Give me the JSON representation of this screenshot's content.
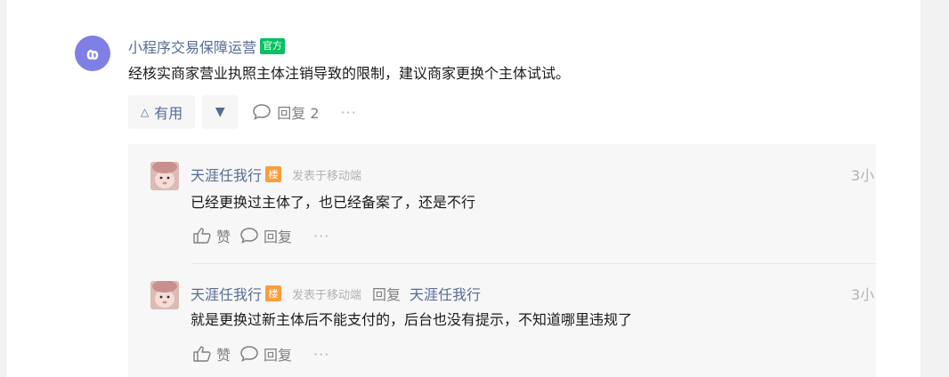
{
  "official_reply": {
    "author": "小程序交易保障运营",
    "badge": "官方",
    "content": "经核实商家营业执照主体注销导致的限制，建议商家更换个主体试试。",
    "useful_label": "有用",
    "useful_icon": "triangle-up-icon",
    "downvote_icon": "triangle-down-icon",
    "reply_label": "回复 2",
    "more_label": "···"
  },
  "sub_replies": [
    {
      "author": "天涯任我行",
      "badge": "楼",
      "source": "发表于移动端",
      "time": "3小",
      "content": "已经更换过主体了，也已经备案了，还是不行",
      "like_label": "赞",
      "reply_label": "回复",
      "more_label": "···"
    },
    {
      "author": "天涯任我行",
      "badge": "楼",
      "source": "发表于移动端",
      "reply_word": "回复",
      "reply_to": "天涯任我行",
      "time": "3小",
      "content": "就是更换过新主体后不能支付的，后台也没有提示，不知道哪里违规了",
      "like_label": "赞",
      "reply_label": "回复",
      "more_label": "···"
    }
  ],
  "colors": {
    "link": "#576b95",
    "official_green": "#07c160",
    "floor_orange": "#fa9d3b",
    "avatar_purple": "#7f7fe6"
  }
}
